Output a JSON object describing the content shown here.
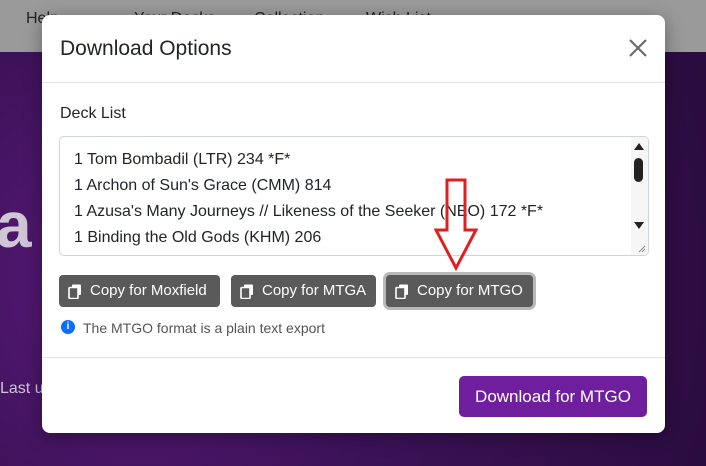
{
  "background": {
    "nav_items": [
      "Help",
      "Your Decks",
      "Collection",
      "Wish List"
    ],
    "hero_text": "a",
    "last_text": "Last u"
  },
  "modal": {
    "title": "Download Options",
    "close_icon": "close-icon",
    "deck_list_label": "Deck List",
    "deck_lines": [
      "1 Tom Bombadil (LTR) 234 *F*",
      "1 Archon of Sun's Grace (CMM) 814",
      "1 Azusa's Many Journeys // Likeness of the Seeker (NEO) 172 *F*",
      "1 Binding the Old Gods (KHM) 206"
    ],
    "buttons": [
      {
        "label": "Copy for Moxfield",
        "icon": "copy-icon"
      },
      {
        "label": "Copy for MTGA",
        "icon": "copy-icon"
      },
      {
        "label": "Copy for MTGO",
        "icon": "copy-icon"
      }
    ],
    "info_icon": "info-icon",
    "info_text": "The MTGO format is a plain text export",
    "download_label": "Download for MTGO"
  },
  "colors": {
    "primary_purple": "#6f1f9e",
    "copy_button": "#5a5a5a",
    "annotation_red": "#e02020",
    "info_blue": "#0d6efd"
  }
}
